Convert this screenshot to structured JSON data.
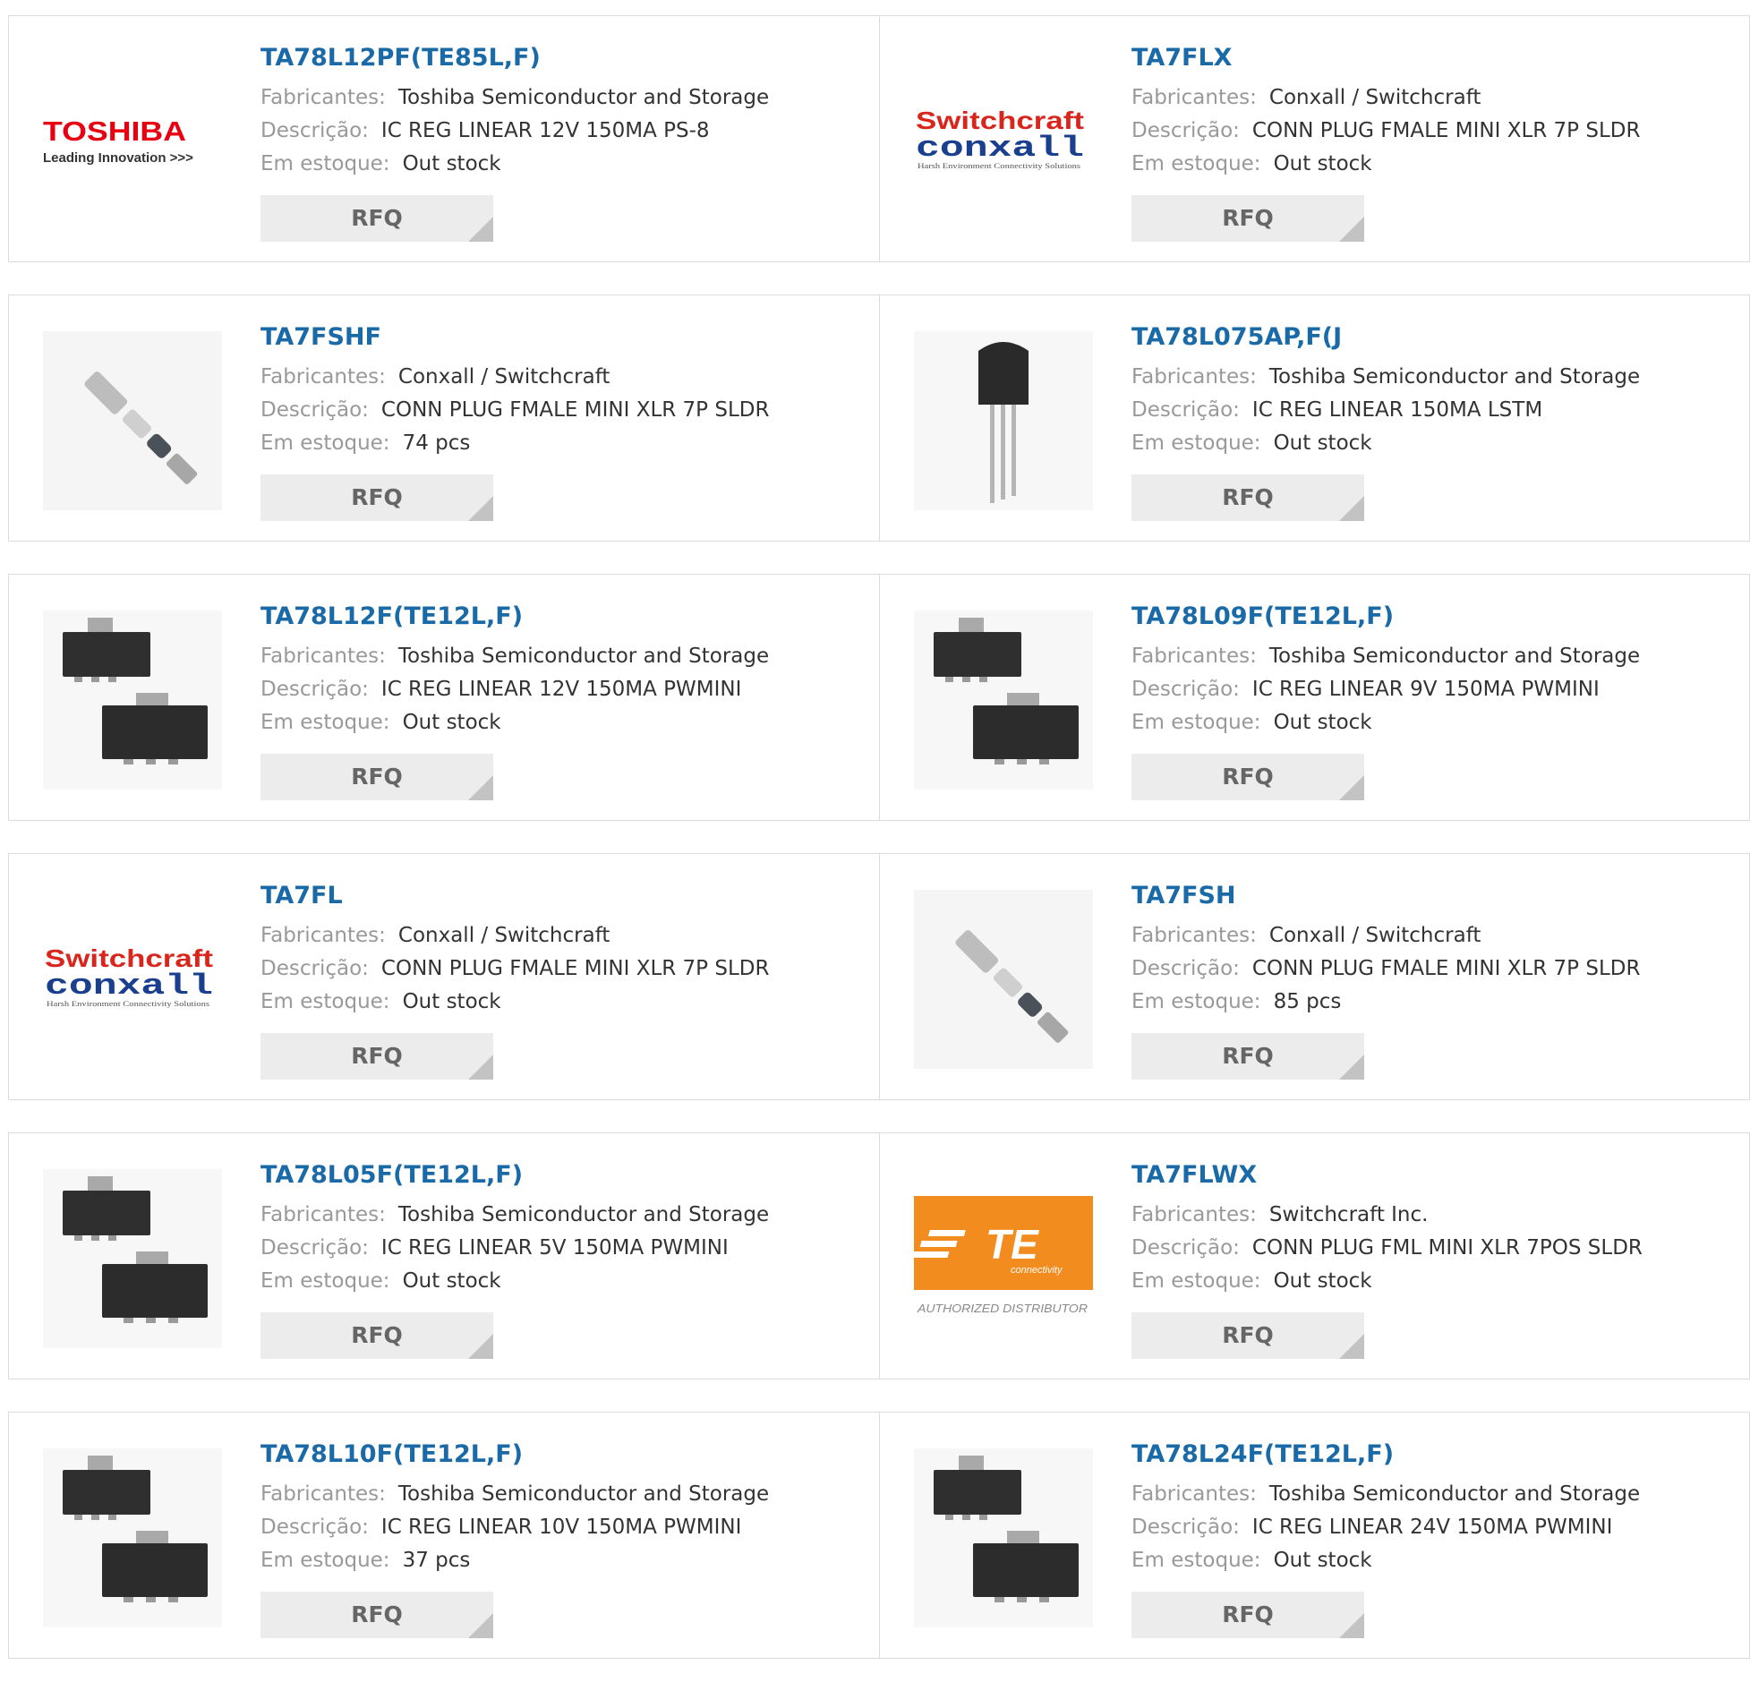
{
  "labels": {
    "manufacturer": "Fabricantes:",
    "description": "Descrição:",
    "stock": "Em estoque:",
    "rfq": "RFQ"
  },
  "logos": {
    "toshiba_main": "TOSHIBA",
    "toshiba_tag": "Leading Innovation >>>",
    "switchcraft_top": "Switchcraft",
    "switchcraft_bottom": "conxall",
    "switchcraft_tag": "Harsh Environment Connectivity Solutions",
    "te_main": "TE",
    "te_sub": "connectivity",
    "te_tag": "AUTHORIZED DISTRIBUTOR"
  },
  "colors": {
    "link": "#1a6aa7",
    "toshiba_red": "#e60012",
    "switchcraft_red": "#d9261c",
    "conxall_blue": "#1a3f8f",
    "te_orange": "#f28c1e",
    "button_bg": "#ececec"
  },
  "products": [
    {
      "part": "TA78L12PF(TE85L,F)",
      "manufacturer": "Toshiba Semiconductor and Storage",
      "description": "IC REG LINEAR 12V 150MA PS-8",
      "stock": "Out stock",
      "image": "toshiba-logo"
    },
    {
      "part": "TA7FLX",
      "manufacturer": "Conxall / Switchcraft",
      "description": "CONN PLUG FMALE MINI XLR 7P SLDR",
      "stock": "Out stock",
      "image": "switchcraft-logo"
    },
    {
      "part": "TA7FSHF",
      "manufacturer": "Conxall / Switchcraft",
      "description": "CONN PLUG FMALE MINI XLR 7P SLDR",
      "stock": "74 pcs",
      "image": "connector-photo"
    },
    {
      "part": "TA78L075AP,F(J",
      "manufacturer": "Toshiba Semiconductor and Storage",
      "description": "IC REG LINEAR 150MA LSTM",
      "stock": "Out stock",
      "image": "to92-photo"
    },
    {
      "part": "TA78L12F(TE12L,F)",
      "manufacturer": "Toshiba Semiconductor and Storage",
      "description": "IC REG LINEAR 12V 150MA PWMINI",
      "stock": "Out stock",
      "image": "sot89-photo"
    },
    {
      "part": "TA78L09F(TE12L,F)",
      "manufacturer": "Toshiba Semiconductor and Storage",
      "description": "IC REG LINEAR 9V 150MA PWMINI",
      "stock": "Out stock",
      "image": "sot89-photo"
    },
    {
      "part": "TA7FL",
      "manufacturer": "Conxall / Switchcraft",
      "description": "CONN PLUG FMALE MINI XLR 7P SLDR",
      "stock": "Out stock",
      "image": "switchcraft-logo"
    },
    {
      "part": "TA7FSH",
      "manufacturer": "Conxall / Switchcraft",
      "description": "CONN PLUG FMALE MINI XLR 7P SLDR",
      "stock": "85 pcs",
      "image": "connector-photo"
    },
    {
      "part": "TA78L05F(TE12L,F)",
      "manufacturer": "Toshiba Semiconductor and Storage",
      "description": "IC REG LINEAR 5V 150MA PWMINI",
      "stock": "Out stock",
      "image": "sot89-photo"
    },
    {
      "part": "TA7FLWX",
      "manufacturer": "Switchcraft Inc.",
      "description": "CONN PLUG FML MINI XLR 7POS SLDR",
      "stock": "Out stock",
      "image": "te-logo"
    },
    {
      "part": "TA78L10F(TE12L,F)",
      "manufacturer": "Toshiba Semiconductor and Storage",
      "description": "IC REG LINEAR 10V 150MA PWMINI",
      "stock": "37 pcs",
      "image": "sot89-photo"
    },
    {
      "part": "TA78L24F(TE12L,F)",
      "manufacturer": "Toshiba Semiconductor and Storage",
      "description": "IC REG LINEAR 24V 150MA PWMINI",
      "stock": "Out stock",
      "image": "sot89-photo"
    }
  ]
}
